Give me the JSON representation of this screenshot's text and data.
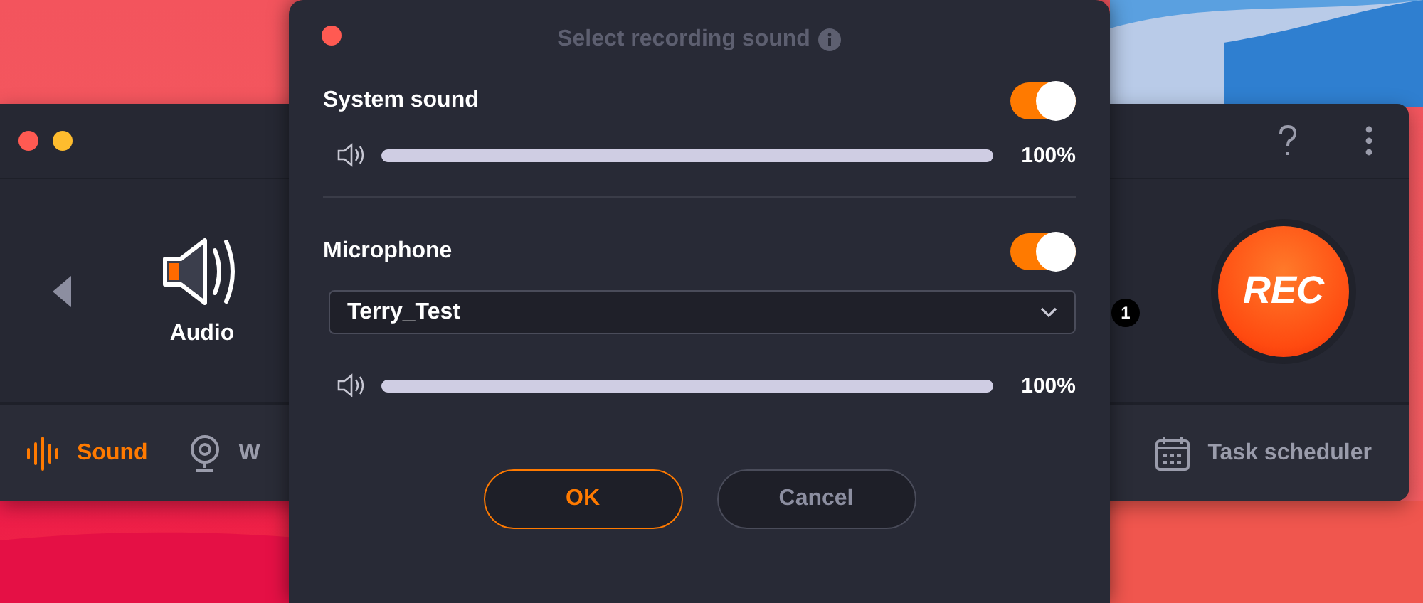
{
  "app": {
    "window_controls": [
      {
        "kind": "close"
      },
      {
        "kind": "minimize"
      }
    ],
    "mode": {
      "label": "Audio"
    },
    "badge": "1",
    "rec_button": "REC",
    "tabs": [
      {
        "label": "Sound",
        "kind": "sound",
        "selected": true
      },
      {
        "label": "W",
        "kind": "webcam",
        "selected": false
      },
      {
        "label": "Task scheduler",
        "kind": "scheduler",
        "selected": false
      }
    ]
  },
  "dialog": {
    "title": "Select recording sound",
    "sources": [
      {
        "name": "System sound",
        "on": true,
        "level": 1,
        "reading": "100%"
      },
      {
        "name": "Microphone",
        "on": true,
        "device": "Terry_Test",
        "level": 1,
        "reading": "100%"
      }
    ],
    "buttons": [
      {
        "label": "OK",
        "kind": "primary"
      },
      {
        "label": "Cancel",
        "kind": "secondary"
      }
    ]
  }
}
